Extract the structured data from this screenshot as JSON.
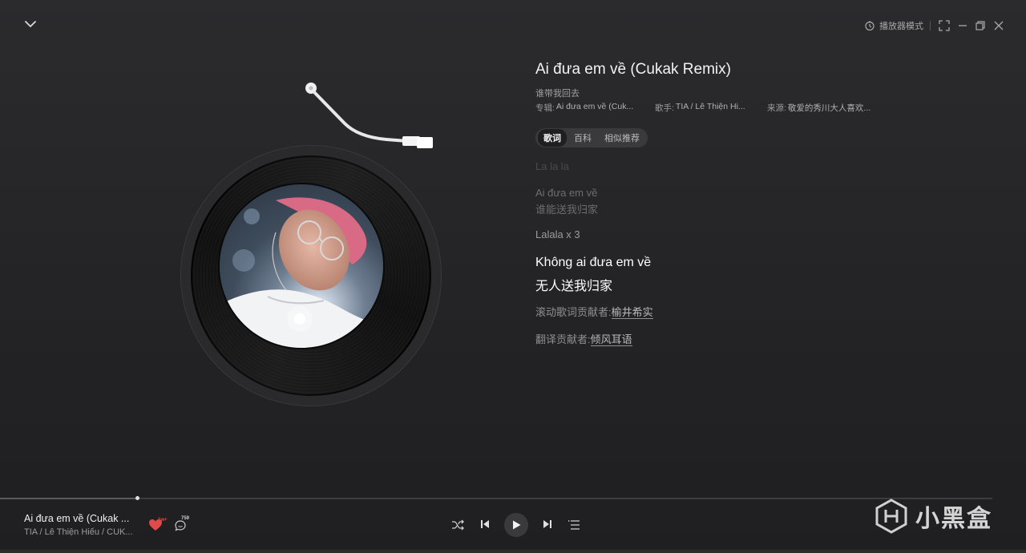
{
  "window": {
    "player_mode_label": "播放器模式"
  },
  "song": {
    "title": "Ai đưa em về (Cukak Remix)",
    "subtitle": "谁带我回去",
    "album_label": "专辑:",
    "album_value": "Ai đưa em về (Cuk...",
    "singer_label": "歌手:",
    "singer_value": "TIA / Lê Thiện Hi...",
    "source_label": "来源:",
    "source_value": "敬爱的秀川大人喜欢..."
  },
  "tabs": [
    {
      "label": "歌词",
      "active": true
    },
    {
      "label": "百科",
      "active": false
    },
    {
      "label": "相似推荐",
      "active": false
    }
  ],
  "lyrics": {
    "line0": "La la la",
    "line1": "Ai đưa em về",
    "line1_translation": "谁能送我归家",
    "line2": "Lalala x 3",
    "current": "Không ai đưa em về",
    "current_translation": "无人送我归家"
  },
  "credits": {
    "lyric_label": "滚动歌词贡献者:",
    "lyric_user": "榆井希实",
    "translate_label": "翻译贡献者:",
    "translate_user": "倾风耳语"
  },
  "progress": {
    "fraction": 0.138
  },
  "now_playing": {
    "title": "Ai đưa em về (Cukak ...",
    "artist": "TIA / Lê Thiện Hiếu / CUK...",
    "like_badge": "1w+",
    "comment_count": "759"
  },
  "colors": {
    "like": "#e04a4a",
    "background": "#252527"
  },
  "watermark": {
    "text": "小黑盒"
  }
}
